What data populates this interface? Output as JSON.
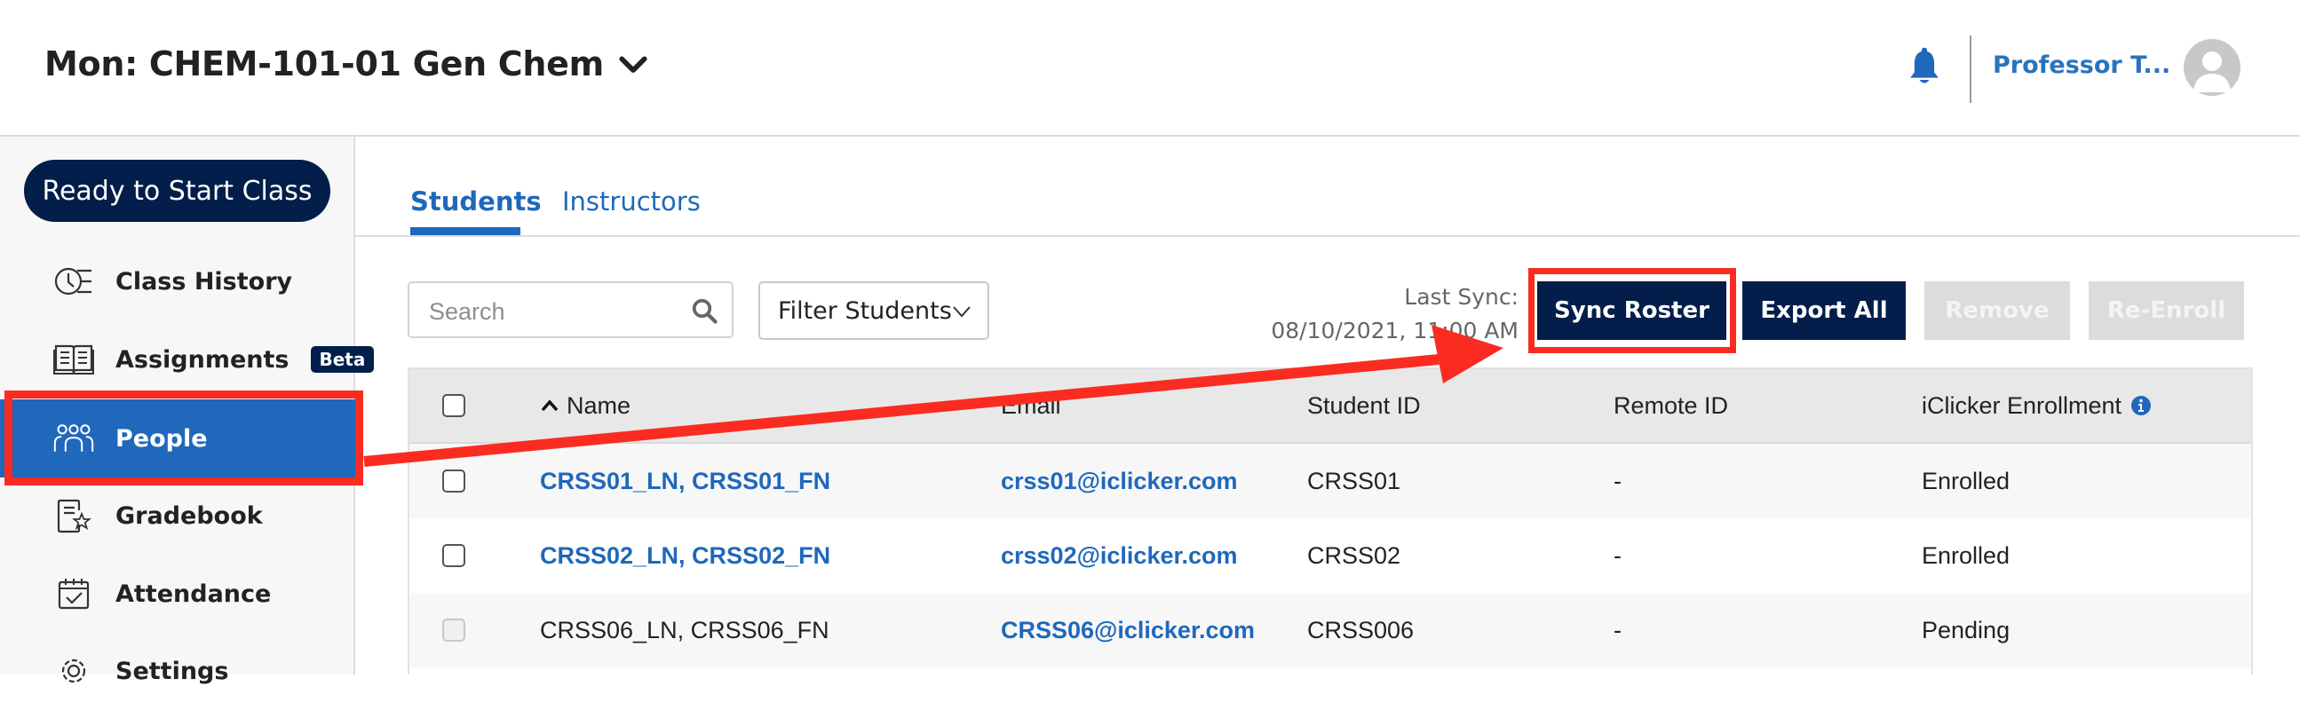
{
  "header": {
    "course_title": "Mon: CHEM-101-01 Gen Chem",
    "user_name": "Professor T...",
    "icons": {
      "course_dropdown": "chevron-down-icon",
      "notifications": "bell-icon",
      "avatar": "user-avatar-icon"
    }
  },
  "sidebar": {
    "ready_button": "Ready to Start Class",
    "items": [
      {
        "label": "Class History",
        "icon": "clock-list-icon",
        "active": false
      },
      {
        "label": "Assignments",
        "icon": "book-icon",
        "active": false,
        "badge": "Beta"
      },
      {
        "label": "People",
        "icon": "people-icon",
        "active": true
      },
      {
        "label": "Gradebook",
        "icon": "gradebook-star-icon",
        "active": false
      },
      {
        "label": "Attendance",
        "icon": "calendar-check-icon",
        "active": false
      },
      {
        "label": "Settings",
        "icon": "gear-icon",
        "active": false
      }
    ]
  },
  "tabs": [
    {
      "label": "Students",
      "active": true
    },
    {
      "label": "Instructors",
      "active": false
    }
  ],
  "toolbar": {
    "search_placeholder": "Search",
    "search_value": "",
    "filter_label": "Filter Students",
    "last_sync_label": "Last Sync:",
    "last_sync_value": "08/10/2021, 11:00 AM",
    "sync_button": "Sync Roster",
    "export_button": "Export All",
    "remove_button": "Remove",
    "reenroll_button": "Re-Enroll"
  },
  "table": {
    "columns": [
      "Name",
      "Email",
      "Student ID",
      "Remote ID",
      "iClicker Enrollment"
    ],
    "sort": {
      "column": "Name",
      "direction": "ascending"
    },
    "rows": [
      {
        "name": "CRSS01_LN, CRSS01_FN",
        "email": "crss01@iclicker.com",
        "student_id": "CRSS01",
        "remote_id": "-",
        "enrollment": "Enrolled",
        "checkbox_enabled": true,
        "name_link": true
      },
      {
        "name": "CRSS02_LN, CRSS02_FN",
        "email": "crss02@iclicker.com",
        "student_id": "CRSS02",
        "remote_id": "-",
        "enrollment": "Enrolled",
        "checkbox_enabled": true,
        "name_link": true
      },
      {
        "name": "CRSS06_LN, CRSS06_FN",
        "email": "CRSS06@iclicker.com",
        "student_id": "CRSS006",
        "remote_id": "-",
        "enrollment": "Pending",
        "checkbox_enabled": false,
        "name_link": false
      }
    ]
  },
  "annotations": {
    "highlight_color": "#fa2c22",
    "description": "Arrow from People sidebar item to Sync Roster button"
  },
  "colors": {
    "brand_navy": "#031e4a",
    "accent_blue": "#1f68bb",
    "disabled_gray": "#dcdcdc"
  }
}
